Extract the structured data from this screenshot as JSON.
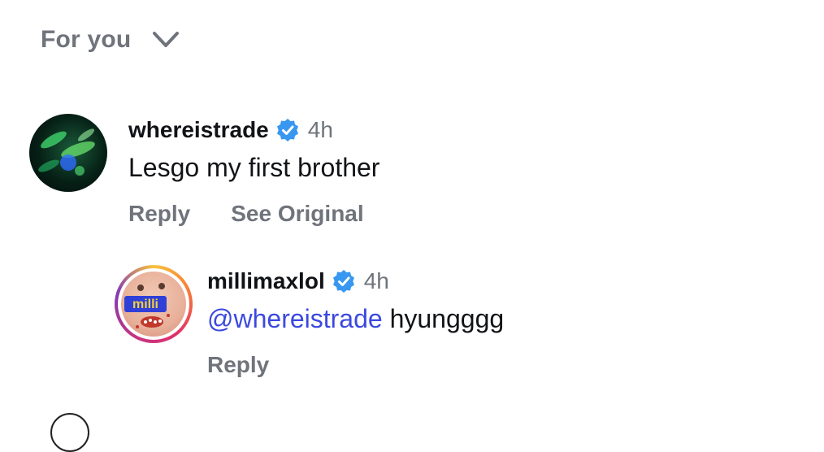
{
  "sort": {
    "label": "For you"
  },
  "comments": [
    {
      "username": "whereistrade",
      "time": "4h",
      "text": "Lesgo my first brother",
      "actions": [
        "Reply",
        "See Original"
      ]
    },
    {
      "username": "millimaxlol",
      "time": "4h",
      "mention": "@whereistrade",
      "text": " hyungggg",
      "actions": [
        "Reply"
      ],
      "avatar_text": "milli"
    }
  ],
  "colors": {
    "verified": "#3897f0",
    "mention": "#3b49df",
    "muted": "#6f737b"
  }
}
